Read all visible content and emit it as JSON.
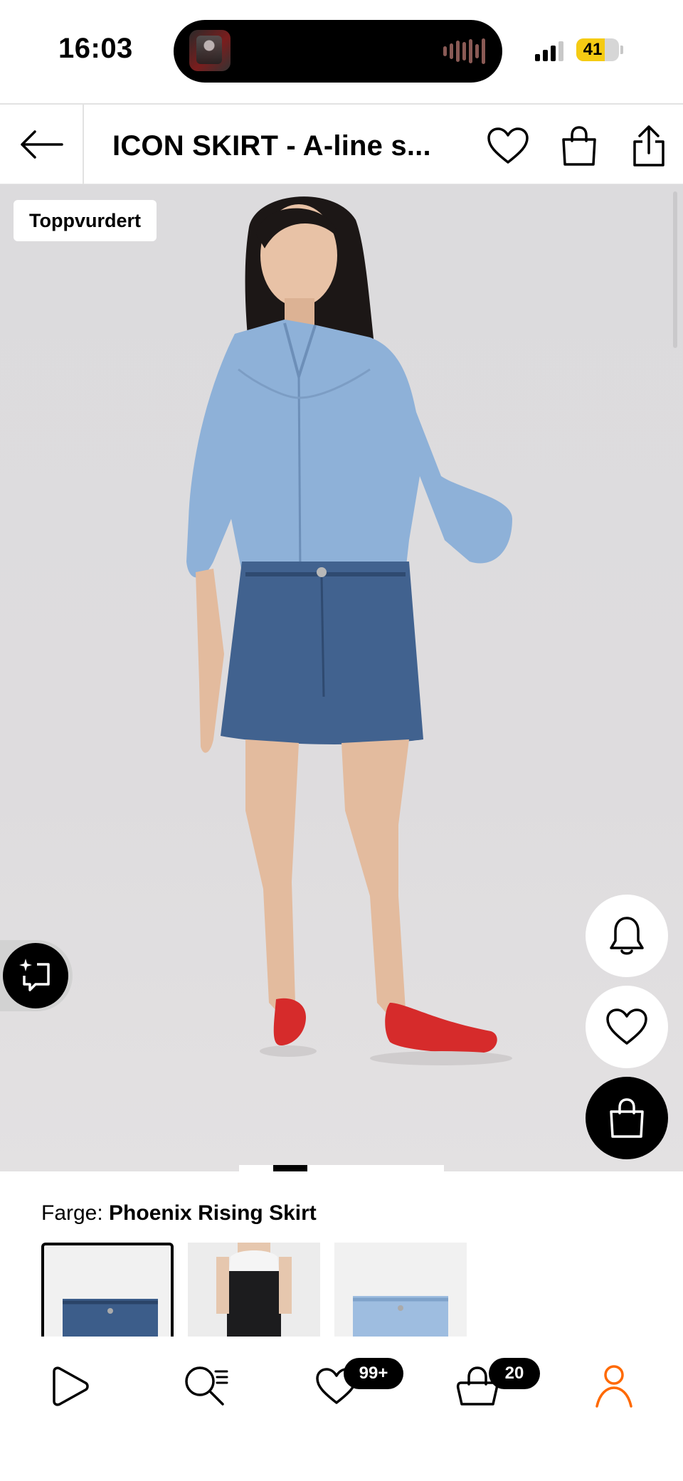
{
  "status_bar": {
    "time": "16:03",
    "battery": "41",
    "colors": {
      "battery_fill": "#f5cb13"
    }
  },
  "header": {
    "title": "ICON SKIRT - A-line s...",
    "back_icon": "arrow-left-icon",
    "wishlist_icon": "heart-icon",
    "bag_icon": "shopping-bag-icon",
    "share_icon": "share-icon"
  },
  "product_image": {
    "badge": "Toppvurdert",
    "floating_actions": [
      "bell-icon",
      "heart-icon",
      "shopping-bag-icon"
    ],
    "ai_button_icon": "sparkle-chat-icon",
    "page_indicator": {
      "current": 1
    }
  },
  "color_selector": {
    "label": "Farge:",
    "selected_value": "Phoenix Rising Skirt",
    "swatch_count_visible": 3
  },
  "bottom_nav": {
    "items": [
      {
        "icon": "play-icon",
        "label": ""
      },
      {
        "icon": "search-list-icon",
        "label": ""
      },
      {
        "icon": "heart-icon",
        "badge": "99+"
      },
      {
        "icon": "shopping-bag-icon",
        "badge": "20"
      },
      {
        "icon": "profile-icon",
        "active": true
      }
    ],
    "colors": {
      "active": "#ff6900"
    }
  }
}
